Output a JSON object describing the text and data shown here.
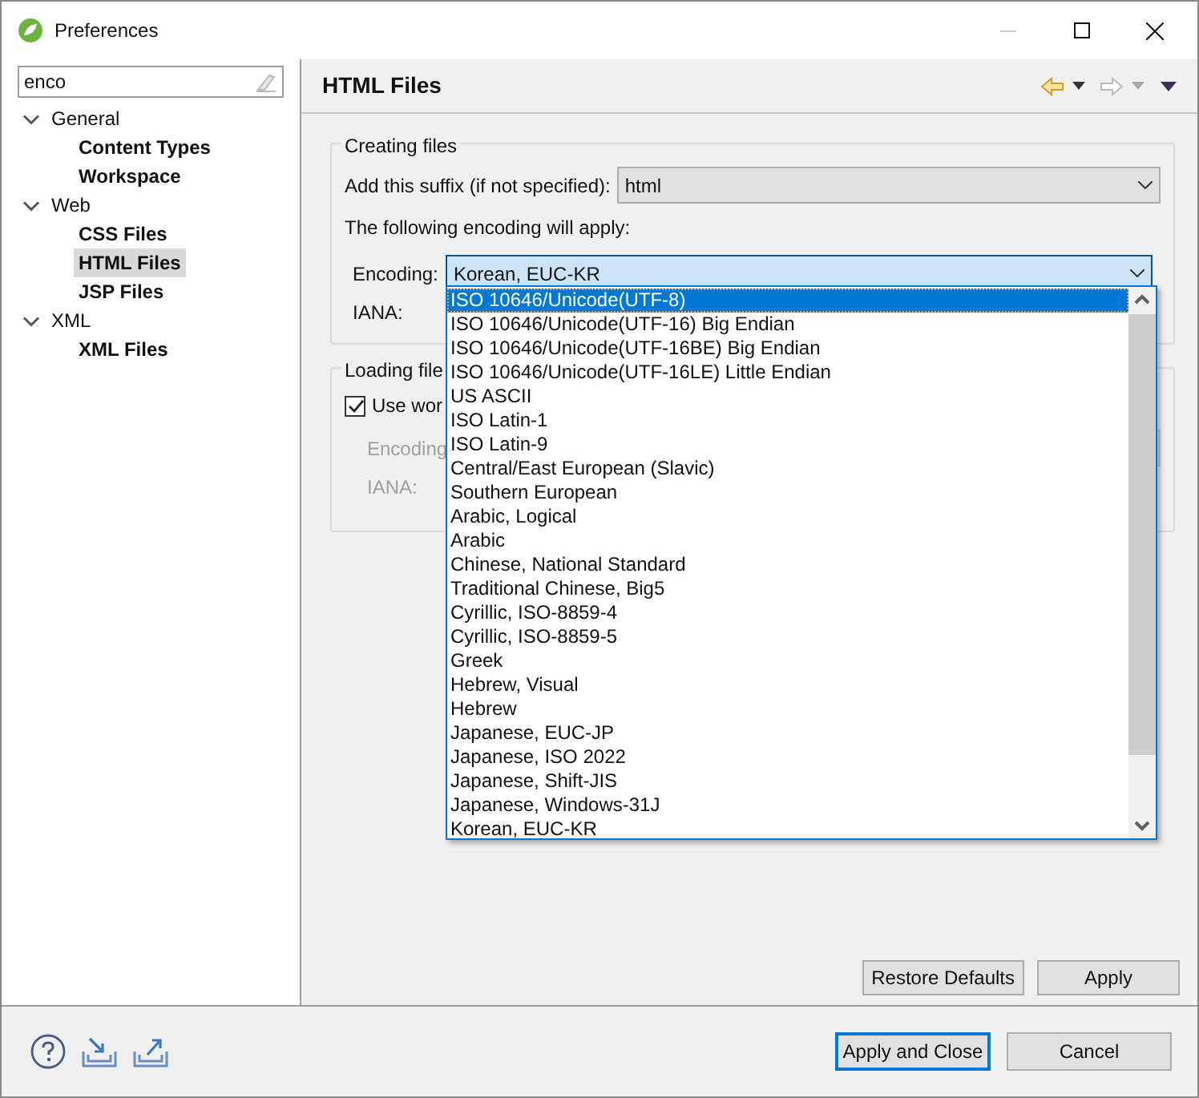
{
  "window": {
    "title": "Preferences"
  },
  "filter": {
    "value": "enco"
  },
  "tree": [
    {
      "label": "General",
      "expanded": true,
      "children": [
        {
          "label": "Content Types",
          "selected": false
        },
        {
          "label": "Workspace",
          "selected": false
        }
      ]
    },
    {
      "label": "Web",
      "expanded": true,
      "children": [
        {
          "label": "CSS Files",
          "selected": false
        },
        {
          "label": "HTML Files",
          "selected": true
        },
        {
          "label": "JSP Files",
          "selected": false
        }
      ]
    },
    {
      "label": "XML",
      "expanded": true,
      "children": [
        {
          "label": "XML Files",
          "selected": false
        }
      ]
    }
  ],
  "page": {
    "title": "HTML Files"
  },
  "creating_files": {
    "title": "Creating files",
    "suffix_label": "Add this suffix (if not specified):",
    "suffix_value": "html",
    "encoding_note": "The following encoding will apply:",
    "encoding_label": "Encoding:",
    "encoding_value": "Korean, EUC-KR",
    "iana_label": "IANA:"
  },
  "encoding_dropdown": {
    "items": [
      {
        "label": "ISO 10646/Unicode(UTF-8)",
        "selected": true
      },
      {
        "label": "ISO 10646/Unicode(UTF-16) Big Endian",
        "selected": false
      },
      {
        "label": "ISO 10646/Unicode(UTF-16BE) Big Endian",
        "selected": false
      },
      {
        "label": "ISO 10646/Unicode(UTF-16LE) Little Endian",
        "selected": false
      },
      {
        "label": "US ASCII",
        "selected": false
      },
      {
        "label": "ISO Latin-1",
        "selected": false
      },
      {
        "label": "ISO Latin-9",
        "selected": false
      },
      {
        "label": "Central/East European (Slavic)",
        "selected": false
      },
      {
        "label": "Southern European",
        "selected": false
      },
      {
        "label": "Arabic, Logical",
        "selected": false
      },
      {
        "label": "Arabic",
        "selected": false
      },
      {
        "label": "Chinese, National Standard",
        "selected": false
      },
      {
        "label": "Traditional Chinese, Big5",
        "selected": false
      },
      {
        "label": "Cyrillic, ISO-8859-4",
        "selected": false
      },
      {
        "label": "Cyrillic, ISO-8859-5",
        "selected": false
      },
      {
        "label": "Greek",
        "selected": false
      },
      {
        "label": "Hebrew, Visual",
        "selected": false
      },
      {
        "label": "Hebrew",
        "selected": false
      },
      {
        "label": "Japanese, EUC-JP",
        "selected": false
      },
      {
        "label": "Japanese, ISO 2022",
        "selected": false
      },
      {
        "label": "Japanese, Shift-JIS",
        "selected": false
      },
      {
        "label": "Japanese, Windows-31J",
        "selected": false
      },
      {
        "label": "Korean, EUC-KR",
        "selected": false
      }
    ]
  },
  "loading_files": {
    "title": "Loading file",
    "checkbox": {
      "label": "Use wor",
      "checked": true
    },
    "encoding_label": "Encoding",
    "iana_label": "IANA:"
  },
  "page_buttons": [
    "Restore Defaults",
    "Apply"
  ],
  "dialog_buttons": [
    "Apply and Close",
    "Cancel"
  ]
}
